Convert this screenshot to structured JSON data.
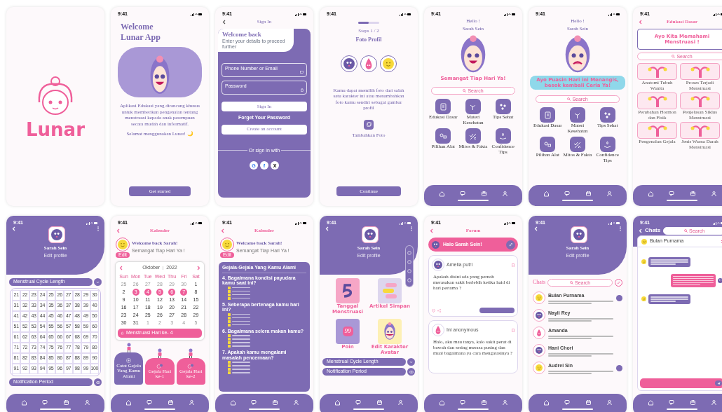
{
  "screens": [
    {
      "kind": "splash",
      "logo": "Lunar"
    },
    {
      "kind": "welcome",
      "time": "9:41",
      "title": [
        "Welcome",
        "Lunar App"
      ],
      "description": "Aplikasi Edukasi yang dirancang khusus untuk memberikan pengenalan tentang menstruasi kepada anak perempuan secara mudah dan informatif.",
      "note": "Selamat menggunakan Lunar! 🌙",
      "button": "Get started"
    },
    {
      "kind": "signin",
      "time": "9:41",
      "header": "Sign In",
      "title": "Welcome back",
      "subtitle": "Enter your details to proceed further",
      "fields": [
        "Phone Number or Email",
        "Password"
      ],
      "primary": "Sign In",
      "link": "Forget Your Password",
      "secondary": "Create an account",
      "divider": "Or sign in with",
      "socials": [
        "G",
        "f",
        "X"
      ]
    },
    {
      "kind": "avatar_pick",
      "time": "9:41",
      "progress": {
        "level": 0.5
      },
      "step": "Steps 1 / 2",
      "title": "Foto Profil",
      "avatars": [
        {
          "kind": "blob"
        },
        {
          "kind": "drop"
        },
        {
          "kind": "smiley"
        }
      ],
      "description": "Kamu dapat memilih foto dari salah satu karakter ini atau menambahkan foto kamu sendiri sebagai gambar profil",
      "add_label": "Tambahkan Foto",
      "button": "Continue"
    },
    {
      "kind": "home",
      "time": "9:41",
      "greeting": "Hello !",
      "name": "Sarah Sein",
      "face": {
        "kind": "happy"
      },
      "banner": "Semangat Tiap Hari Ya!",
      "search": "Search",
      "menu": [
        "Edukasi Dasar",
        "Materi Kesehatan",
        "Tips Sehat",
        "Pilihan Alat",
        "Mitos & Fakta",
        "Confidence Tips"
      ]
    },
    {
      "kind": "home",
      "time": "9:41",
      "greeting": "Hello !",
      "name": "Sarah Sein",
      "face": {
        "kind": "sad"
      },
      "banner": "Ayo Puasin Hari ini Menangis, besok kembali Ceria Ya!",
      "search": "Search",
      "menu": [
        "Edukasi Dasar",
        "Materi Kesehatan",
        "Tips Sehat",
        "Pilihan Alat",
        "Mitos & Fakta",
        "Confidence Tips"
      ]
    },
    {
      "kind": "education",
      "time": "9:41",
      "title": "Edukasi Dasar",
      "banner": "Ayo Kita Memahami Menstruasi !",
      "search": "Search",
      "topics": [
        "Anatomi Tubuh Wanita",
        "Proses Terjadi Menstruasi",
        "Perubahan Hormon dan Fisik",
        "Penjelasan Siklus Menstruasi",
        "Pengenalan Gejala",
        "Jenis Warna Darah Menstruasi"
      ]
    },
    {
      "kind": "profile_cycle",
      "time": "9:41",
      "name": "Sarah Sein",
      "edit": "Edit profile",
      "cycle_field": "Menstrual Cycle Length",
      "grid": [
        "21",
        "22",
        "23",
        "24",
        "25",
        "26",
        "27",
        "28",
        "29",
        "30",
        "31",
        "32",
        "33",
        "34",
        "35",
        "36",
        "37",
        "38",
        "39",
        "40",
        "41",
        "42",
        "43",
        "44",
        "45",
        "46",
        "47",
        "48",
        "49",
        "50",
        "51",
        "52",
        "53",
        "54",
        "55",
        "56",
        "57",
        "58",
        "59",
        "60",
        "61",
        "62",
        "63",
        "64",
        "65",
        "66",
        "67",
        "68",
        "69",
        "70",
        "71",
        "72",
        "73",
        "74",
        "75",
        "76",
        "77",
        "78",
        "79",
        "80",
        "81",
        "82",
        "83",
        "84",
        "85",
        "86",
        "87",
        "88",
        "89",
        "90",
        "91",
        "92",
        "93",
        "94",
        "95",
        "96",
        "97",
        "98",
        "99",
        "100"
      ],
      "notification": "Notification Period"
    },
    {
      "kind": "calendar",
      "time": "9:41",
      "title": "Kalender",
      "welcome": "Welcome back Sarah!",
      "sub": "Semangat Tiap Hari Ya !",
      "edit": "Edit",
      "month": "Oktober",
      "year": "2022",
      "weekdays": [
        "Sun",
        "Mon",
        "Tue",
        "Wed",
        "Thu",
        "Fri",
        "Sat"
      ],
      "days": [
        {
          "label": "25",
          "muted": true,
          "selected": false
        },
        {
          "label": "26",
          "muted": true,
          "selected": false
        },
        {
          "label": "27",
          "muted": true,
          "selected": false
        },
        {
          "label": "28",
          "muted": true,
          "selected": false
        },
        {
          "label": "29",
          "muted": true,
          "selected": false
        },
        {
          "label": "30",
          "muted": true,
          "selected": false
        },
        {
          "label": "1",
          "muted": false,
          "selected": false
        },
        {
          "label": "2",
          "muted": false,
          "selected": false
        },
        {
          "label": "3",
          "muted": false,
          "selected": true
        },
        {
          "label": "4",
          "muted": false,
          "selected": true
        },
        {
          "label": "5",
          "muted": false,
          "selected": true
        },
        {
          "label": "6",
          "muted": false,
          "selected": true
        },
        {
          "label": "7",
          "muted": false,
          "selected": true
        },
        {
          "label": "8",
          "muted": false,
          "selected": false
        },
        {
          "label": "9",
          "muted": false,
          "selected": false
        },
        {
          "label": "10",
          "muted": false,
          "selected": false
        },
        {
          "label": "11",
          "muted": false,
          "selected": false
        },
        {
          "label": "12",
          "muted": false,
          "selected": false
        },
        {
          "label": "13",
          "muted": false,
          "selected": false
        },
        {
          "label": "14",
          "muted": false,
          "selected": false
        },
        {
          "label": "15",
          "muted": false,
          "selected": false
        },
        {
          "label": "16",
          "muted": false,
          "selected": false
        },
        {
          "label": "17",
          "muted": false,
          "selected": false
        },
        {
          "label": "18",
          "muted": false,
          "selected": false
        },
        {
          "label": "19",
          "muted": false,
          "selected": false
        },
        {
          "label": "20",
          "muted": false,
          "selected": false
        },
        {
          "label": "21",
          "muted": false,
          "selected": false
        },
        {
          "label": "22",
          "muted": false,
          "selected": false
        },
        {
          "label": "23",
          "muted": false,
          "selected": false
        },
        {
          "label": "24",
          "muted": false,
          "selected": false
        },
        {
          "label": "25",
          "muted": false,
          "selected": false
        },
        {
          "label": "26",
          "muted": false,
          "selected": false
        },
        {
          "label": "27",
          "muted": false,
          "selected": false
        },
        {
          "label": "28",
          "muted": false,
          "selected": false
        },
        {
          "label": "29",
          "muted": false,
          "selected": false
        },
        {
          "label": "30",
          "muted": false,
          "selected": false
        },
        {
          "label": "31",
          "muted": false,
          "selected": false
        },
        {
          "label": "1",
          "muted": true,
          "selected": false
        },
        {
          "label": "2",
          "muted": true,
          "selected": false
        },
        {
          "label": "3",
          "muted": true,
          "selected": false
        },
        {
          "label": "4",
          "muted": true,
          "selected": false
        },
        {
          "label": "5",
          "muted": true,
          "selected": false
        }
      ],
      "period": "Menstruasi Hari ke- 4",
      "cards": [
        {
          "kind": "add",
          "label": "Catat Gejala Yang Kamu Alami"
        },
        {
          "kind": "day",
          "label": "Gejala Hari ke-1"
        },
        {
          "kind": "day",
          "label": "Gejala Hari ke-2"
        }
      ]
    },
    {
      "kind": "symptoms",
      "time": "9:41",
      "title": "Kalender",
      "welcome": "Welcome back Sarah!",
      "sub": "Semangat Tiap Hari Ya !",
      "edit": "Edit",
      "panel_title": "Gejala-Gejala Yang Kamu Alami",
      "questions": [
        {
          "text": "4. Bagaimana kondisi payudara kamu saat ini?",
          "options": [
            {
              "checked": false
            },
            {
              "checked": false
            },
            {
              "checked": false
            },
            {
              "checked": false
            }
          ]
        },
        {
          "text": "5. Seberapa bertenaga kamu hari ini?",
          "options": [
            {
              "checked": false
            },
            {
              "checked": false
            },
            {
              "checked": false
            },
            {
              "checked": false
            }
          ]
        },
        {
          "text": "6. Bagaimana selera makan kamu?",
          "options": [
            {
              "checked": false
            },
            {
              "checked": false
            },
            {
              "checked": false
            },
            {
              "checked": false
            }
          ]
        },
        {
          "text": "7. Apakah kamu mengalami masalah pencernaan?",
          "options": [
            {
              "checked": false
            },
            {
              "checked": false
            },
            {
              "checked": false
            },
            {
              "checked": false
            }
          ]
        }
      ]
    },
    {
      "kind": "profile_menu",
      "time": "9:41",
      "name": "Sarah Sein",
      "edit": "Edit profile",
      "tiles": [
        {
          "kind": "five",
          "label": "Tanggal Menstruasi"
        },
        {
          "kind": "bubbles",
          "label": "Artikel Simpan"
        },
        {
          "kind": "points",
          "label": "Poin",
          "value": "99"
        },
        {
          "kind": "avatar",
          "label": "Edit Karakter Avatar"
        }
      ],
      "fields": [
        "Menstrual Cycle Length",
        "Notification Period"
      ]
    },
    {
      "kind": "forum",
      "time": "9:41",
      "title": "Forum",
      "hello": "Halo Sarah Sein!",
      "posts": [
        {
          "author": "Amelia putri",
          "avatar": {
            "kind": "blob"
          },
          "text": "Apakah disini ada yang pernah merasakan sakit berlebih ketika haid di hari pertama ?",
          "actions": true
        },
        {
          "author": "Ini anonymous",
          "avatar": {
            "kind": "drop"
          },
          "text": "Halo, aku mau tanya, kalo sakit perut di bawah dan sering merasa pusing dan mual bagaimana ya cara mengatasinya ?",
          "actions": false
        }
      ]
    },
    {
      "kind": "chats",
      "time": "9:41",
      "name": "Sarah Sein",
      "edit": "Edit profile",
      "title": "Chats",
      "search": "Search",
      "items": [
        {
          "name": "Bulan Purnama",
          "avatar": {
            "kind": "smiley"
          },
          "unread": true
        },
        {
          "name": "Nayli Rey",
          "avatar": {
            "kind": "blob"
          },
          "unread": false
        },
        {
          "name": "Amanda",
          "avatar": {
            "kind": "drop"
          },
          "unread": false
        },
        {
          "name": "Hani Chori",
          "avatar": {
            "kind": "blob"
          },
          "unread": false
        },
        {
          "name": "Audrei Sin",
          "avatar": {
            "kind": "smiley"
          },
          "unread": true
        }
      ]
    },
    {
      "kind": "chat",
      "time": "9:41",
      "title": "Chats",
      "search": "Search",
      "contact": "Bulan Purnama",
      "messages": [
        {
          "outgoing": false
        },
        {
          "outgoing": true
        },
        {
          "outgoing": false
        }
      ]
    }
  ]
}
